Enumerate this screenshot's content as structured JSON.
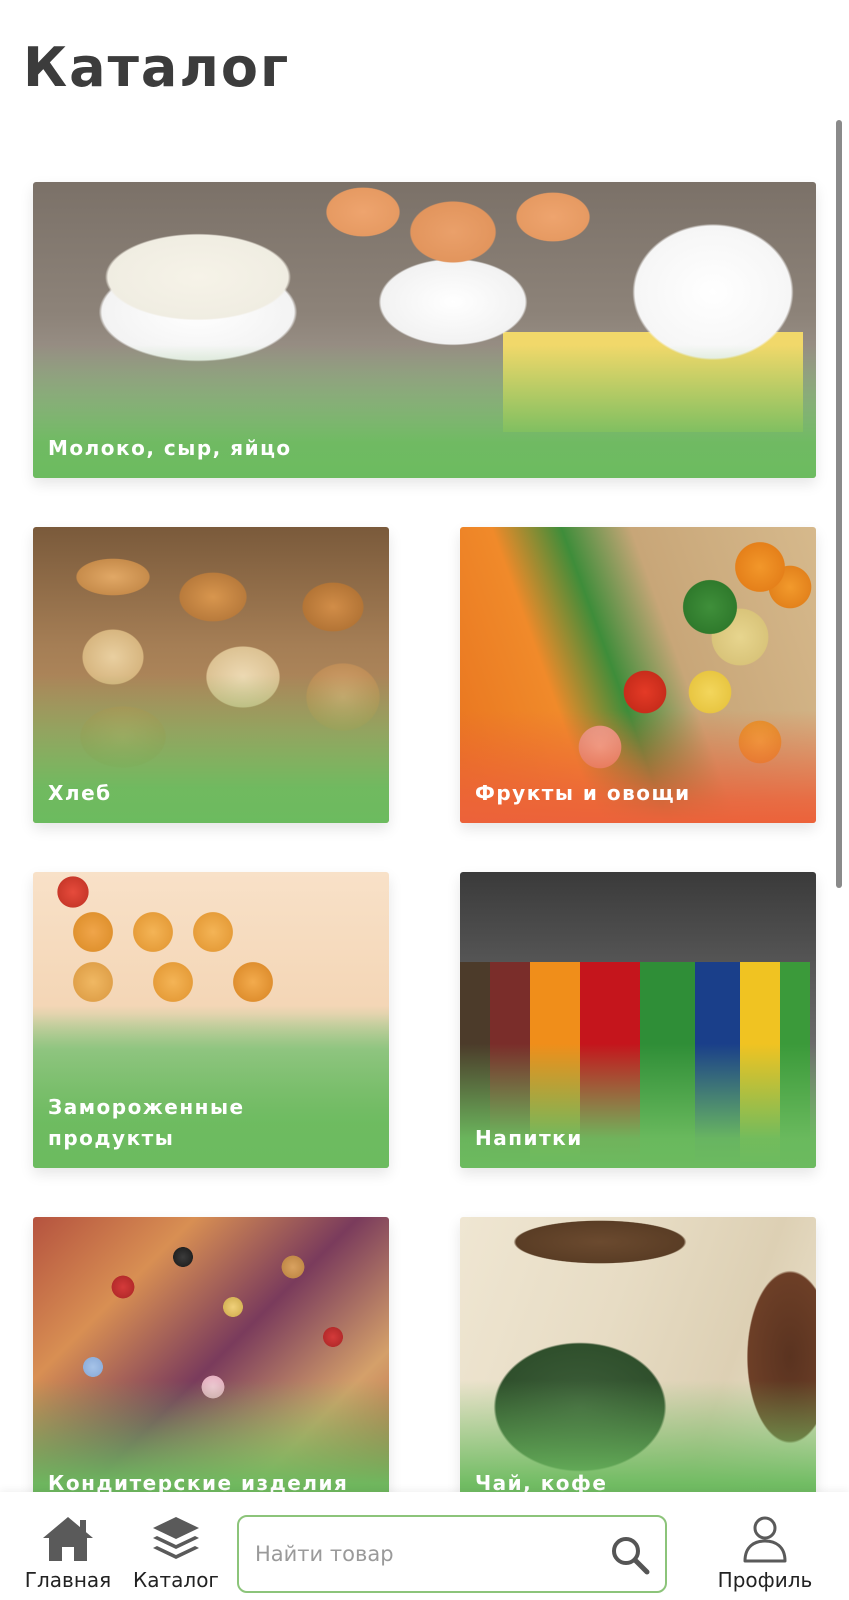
{
  "header": {
    "title": "Каталог"
  },
  "categories": [
    {
      "label_line1": "Молоко, сыр, яйцо",
      "label_line2": ""
    },
    {
      "label_line1": "Хлеб",
      "label_line2": ""
    },
    {
      "label_line1": "Фрукты и овощи",
      "label_line2": ""
    },
    {
      "label_line1": "Замороженные",
      "label_line2": "продукты"
    },
    {
      "label_line1": "Напитки",
      "label_line2": ""
    },
    {
      "label_line1": "Кондитерские изделия",
      "label_line2": ""
    },
    {
      "label_line1": "Чай, кофе",
      "label_line2": ""
    }
  ],
  "bottom_nav": {
    "home_label": "Главная",
    "home_icon": "home-icon",
    "catalog_label": "Каталог",
    "catalog_icon": "layers-icon",
    "search_placeholder": "Найти товар",
    "search_value": "",
    "search_icon": "search-icon",
    "profile_label": "Профиль",
    "profile_icon": "user-icon"
  },
  "colors": {
    "accent_green": "#6cbb5f",
    "accent_orange": "#ec623a",
    "search_border": "#8cc47a",
    "title_text": "#3c3c3c"
  }
}
